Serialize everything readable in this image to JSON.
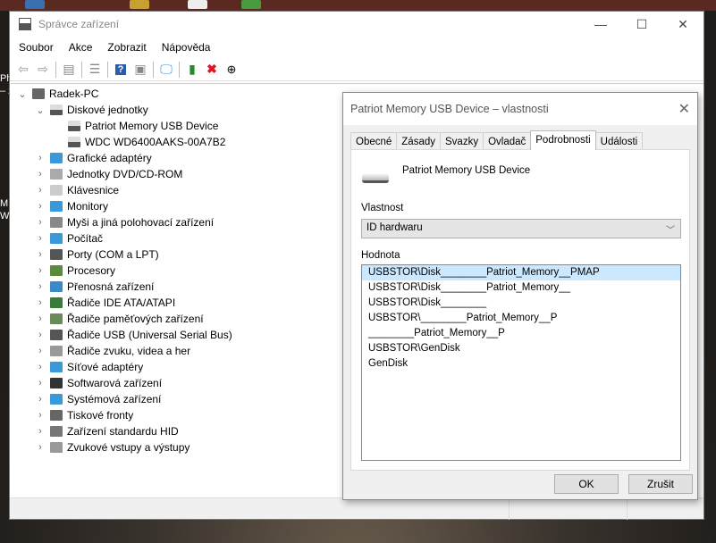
{
  "desktop": {
    "side_labels": [
      "Ph",
      "– z",
      "M",
      "W"
    ]
  },
  "window": {
    "title": "Správce zařízení",
    "controls": {
      "minimize": "—",
      "maximize": "☐",
      "close": "✕"
    },
    "menu": [
      "Soubor",
      "Akce",
      "Zobrazit",
      "Nápověda"
    ],
    "toolbar": [
      "back-icon",
      "forward-icon",
      "show-hide-console-tree-icon",
      "properties-icon",
      "help-icon",
      "action-pane-icon",
      "scan-hardware-icon",
      "update-driver-icon",
      "uninstall-icon",
      "disable-icon"
    ],
    "tree": {
      "root": "Radek-PC",
      "expanded": {
        "label": "Diskové jednotky",
        "children": [
          "Patriot Memory USB Device",
          "WDC WD6400AAKS-00A7B2"
        ]
      },
      "categories": [
        "Grafické adaptéry",
        "Jednotky DVD/CD-ROM",
        "Klávesnice",
        "Monitory",
        "Myši a jiná polohovací zařízení",
        "Počítač",
        "Porty (COM a LPT)",
        "Procesory",
        "Přenosná zařízení",
        "Řadiče IDE ATA/ATAPI",
        "Řadiče paměťových zařízení",
        "Řadiče USB (Universal Serial Bus)",
        "Řadiče zvuku, videa a her",
        "Síťové adaptéry",
        "Softwarová zařízení",
        "Systémová zařízení",
        "Tiskové fronty",
        "Zařízení standardu HID",
        "Zvukové vstupy a výstupy"
      ]
    }
  },
  "dialog": {
    "title": "Patriot Memory USB Device – vlastnosti",
    "close": "✕",
    "tabs": [
      "Obecné",
      "Zásady",
      "Svazky",
      "Ovladač",
      "Podrobnosti",
      "Události"
    ],
    "active_tab": "Podrobnosti",
    "device_name": "Patriot Memory USB Device",
    "property_label": "Vlastnost",
    "property_value": "ID hardwaru",
    "value_label": "Hodnota",
    "values": [
      "USBSTOR\\Disk________Patriot_Memory__PMAP",
      "USBSTOR\\Disk________Patriot_Memory__",
      "USBSTOR\\Disk________",
      "USBSTOR\\________Patriot_Memory__P",
      "________Patriot_Memory__P",
      "USBSTOR\\GenDisk",
      "GenDisk"
    ],
    "ok": "OK",
    "cancel": "Zrušit"
  },
  "colors": {
    "selection": "#cce8ff",
    "uninstall": "#e81123",
    "help": "#2a5db0"
  }
}
